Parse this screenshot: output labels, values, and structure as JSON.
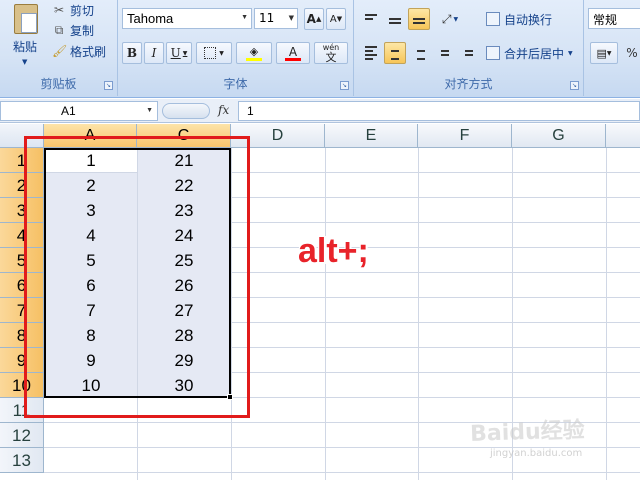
{
  "ribbon": {
    "clipboard": {
      "paste_label": "粘贴",
      "cut_label": "剪切",
      "copy_label": "复制",
      "format_painter_label": "格式刷",
      "group_label": "剪贴板"
    },
    "font": {
      "font_name": "Tahoma",
      "font_size": "11",
      "bold_label": "B",
      "italic_label": "I",
      "underline_label": "U",
      "font_color_label": "A",
      "grow_label": "A",
      "shrink_label": "A",
      "phonetic_label": "wén",
      "group_label": "字体",
      "fill_color": "#ffff00",
      "font_color": "#ff0000"
    },
    "alignment": {
      "wrap_text_label": "自动换行",
      "merge_center_label": "合并后居中",
      "group_label": "对齐方式"
    },
    "number": {
      "format": "常规"
    }
  },
  "formula_bar": {
    "name_box": "A1",
    "fx_label": "fx",
    "formula": "1"
  },
  "sheet": {
    "columns": [
      "A",
      "C",
      "D",
      "E",
      "F",
      "G"
    ],
    "rows": [
      "1",
      "2",
      "3",
      "4",
      "5",
      "6",
      "7",
      "8",
      "9",
      "10",
      "11",
      "12",
      "13"
    ],
    "col_a": [
      "1",
      "2",
      "3",
      "4",
      "5",
      "6",
      "7",
      "8",
      "9",
      "10"
    ],
    "col_c": [
      "21",
      "22",
      "23",
      "24",
      "25",
      "26",
      "27",
      "28",
      "29",
      "30"
    ]
  },
  "annotation": {
    "text": "alt+;",
    "color": "#e8232a"
  },
  "watermark": {
    "text": "Baidu经验",
    "subtext": "jingyan.baidu.com"
  }
}
